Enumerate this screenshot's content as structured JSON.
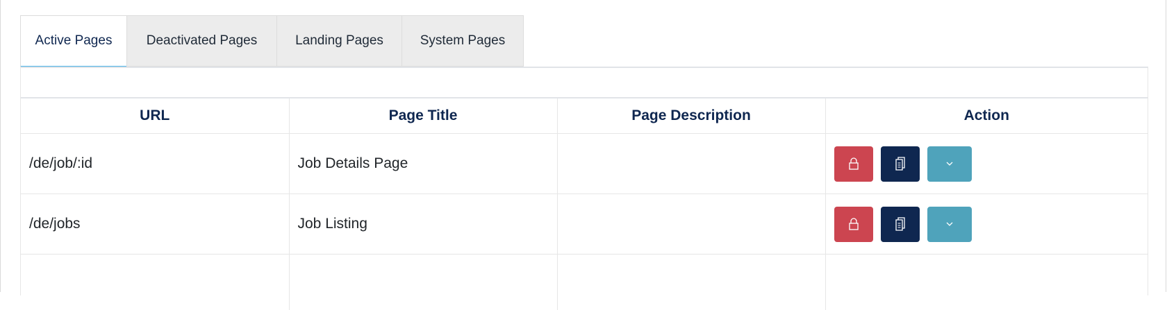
{
  "tabs": [
    {
      "label": "Active Pages",
      "active": true
    },
    {
      "label": "Deactivated Pages",
      "active": false
    },
    {
      "label": "Landing Pages",
      "active": false
    },
    {
      "label": "System Pages",
      "active": false
    }
  ],
  "table": {
    "columns": [
      "URL",
      "Page Title",
      "Page Description",
      "Action"
    ],
    "rows": [
      {
        "url": "/de/job/:id",
        "title": "Job Details Page",
        "description": ""
      },
      {
        "url": "/de/jobs",
        "title": "Job Listing",
        "description": ""
      }
    ]
  },
  "actions": {
    "lock_icon": "lock-icon",
    "copy_icon": "copy-icon",
    "more_icon": "chevron-down-icon"
  },
  "colors": {
    "accent": "#4ab3e8",
    "heading": "#0f2750",
    "lock_button": "#cc4550",
    "copy_button": "#0f2750",
    "more_button": "#4fa3bb"
  }
}
